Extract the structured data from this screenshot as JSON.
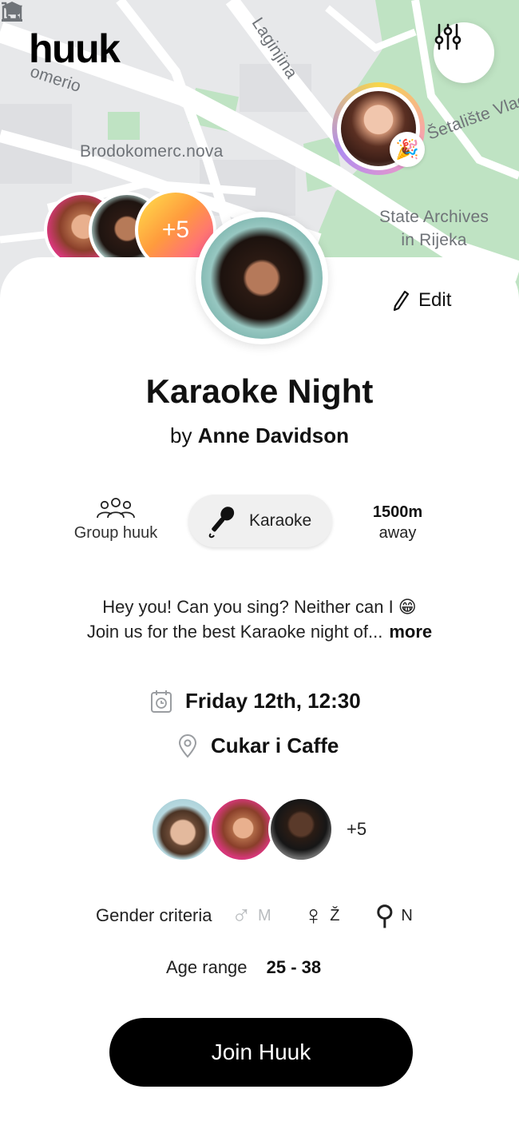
{
  "app": {
    "logo": "huuk"
  },
  "map": {
    "labels": {
      "street_omerio": "omerio",
      "street_laginjina": "Laginjina",
      "street_setaliste": "Šetalište Vladi",
      "shop": "Brodokomerc.nova",
      "archives_line1": "State Archives",
      "archives_line2": "in Rijeka"
    },
    "icons": [
      "cart-icon",
      "museum-icon",
      "party-popper-icon",
      "filter-sliders-icon"
    ],
    "top_group_more": "+5",
    "colors": {
      "park": "#bfe3c3",
      "road": "#ffffff",
      "land": "#e7e8ea"
    }
  },
  "event": {
    "edit_label": "Edit",
    "title": "Karaoke Night",
    "by_prefix": "by",
    "host": "Anne Davidson",
    "type_label": "Group huuk",
    "category": "Karaoke",
    "distance": "1500m",
    "distance_suffix": "away",
    "description_line1": "Hey you! Can you sing? Neither can I 😁",
    "description_line2": "Join us for the best Karaoke night of...",
    "more_label": "more",
    "date": "Friday 12th, 12:30",
    "place": "Cukar i Caffe",
    "attendees_more": "+5",
    "gender_label": "Gender criteria",
    "gender_options": [
      {
        "symbol": "♂",
        "code": "M",
        "active": false
      },
      {
        "symbol": "♀",
        "code": "Ž",
        "active": true
      },
      {
        "symbol": "⚲",
        "code": "N",
        "active": true
      }
    ],
    "age_label": "Age range",
    "age_value": "25 - 38",
    "join_label": "Join Huuk"
  },
  "colors": {
    "accent_pink": "#ff4fa8",
    "accent_yellow": "#ffe14d",
    "button_black": "#000000"
  }
}
